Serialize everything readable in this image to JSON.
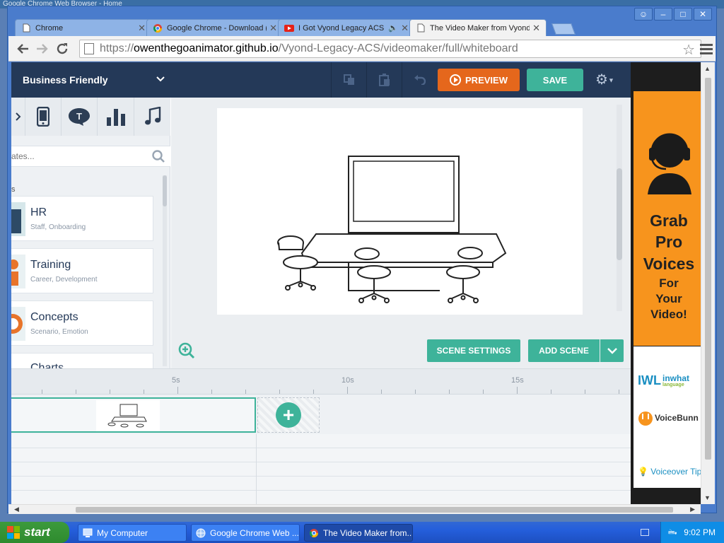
{
  "desktop": {
    "title_fragment": "Google Chrome Web Browser - Home"
  },
  "window_controls": {
    "minimize": "_",
    "restore": "□",
    "close": "✕",
    "user": "👤"
  },
  "tabs": [
    {
      "label": "Chrome",
      "icon": "page-icon"
    },
    {
      "label": "Google Chrome - Download (",
      "icon": "chrome-icon"
    },
    {
      "label": "I Got Vyond Legacy ACS",
      "icon": "youtube-icon",
      "audio": true
    },
    {
      "label": "The Video Maker from Vyond",
      "icon": "page-icon",
      "active": true
    }
  ],
  "omnibox": {
    "scheme": "https://",
    "host": "owenthegoanimator.github.io",
    "path": "/Vyond-Legacy-ACS/videomaker/full/whiteboard"
  },
  "app": {
    "theme_label": "Business Friendly",
    "preview_label": "PREVIEW",
    "save_label": "SAVE",
    "search_placeholder": "ates...",
    "section_letter": "s",
    "categories": [
      {
        "title": "HR",
        "subtitle": "Staff, Onboarding"
      },
      {
        "title": "Training",
        "subtitle": "Career, Development"
      },
      {
        "title": "Concepts",
        "subtitle": "Scenario, Emotion"
      },
      {
        "title": "Charts",
        "subtitle": ""
      }
    ],
    "scene_settings_label": "SCENE SETTINGS",
    "add_scene_label": "ADD SCENE",
    "timeline": {
      "labels": [
        "5s",
        "10s",
        "15s"
      ]
    }
  },
  "ad": {
    "lines": [
      "Grab",
      "Pro",
      "Voices",
      "For",
      "Your",
      "Video!"
    ],
    "logo1": "inwhat",
    "logo1_sub": "language",
    "logo2": "VoiceBunn",
    "tip": "Voiceover Tip"
  },
  "taskbar": {
    "start_label": "start",
    "items": [
      {
        "label": "My Computer"
      },
      {
        "label": "Google Chrome Web ..."
      },
      {
        "label": "The Video Maker from...",
        "active": true
      }
    ],
    "clock": "9:02 PM"
  },
  "colors": {
    "accent_green": "#3eb39a",
    "preview_orange": "#e5671c",
    "header_navy": "#243958",
    "ad_orange": "#f7941d"
  }
}
